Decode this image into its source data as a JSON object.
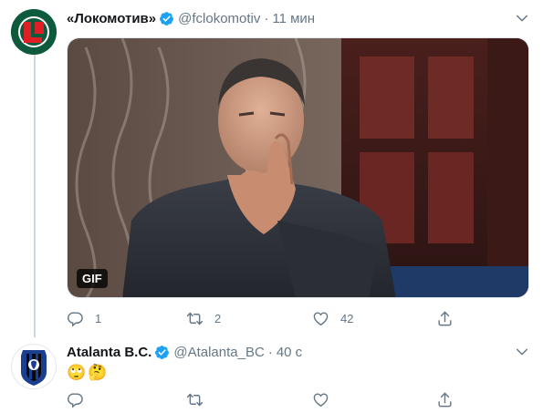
{
  "tweets": [
    {
      "display_name": "«Локомотив»",
      "handle": "@fclokomotiv",
      "separator": "·",
      "time": "11 мин",
      "avatar_icon": "lokomotiv-logo",
      "media": {
        "badge": "GIF",
        "kind": "animated-gif"
      },
      "actions": {
        "reply_count": "1",
        "retweet_count": "2",
        "like_count": "42"
      }
    },
    {
      "display_name": "Atalanta B.C.",
      "handle": "@Atalanta_BC",
      "separator": "·",
      "time": "40 с",
      "avatar_icon": "atalanta-logo",
      "content": "🙄🤔",
      "actions": {
        "reply_count": "",
        "retweet_count": "",
        "like_count": ""
      }
    }
  ],
  "colors": {
    "accent": "#1da1f2",
    "muted": "#657786",
    "border": "#e1e8ed",
    "lokomotiv_green": "#0e5a3c",
    "lokomotiv_red": "#e01e26"
  }
}
